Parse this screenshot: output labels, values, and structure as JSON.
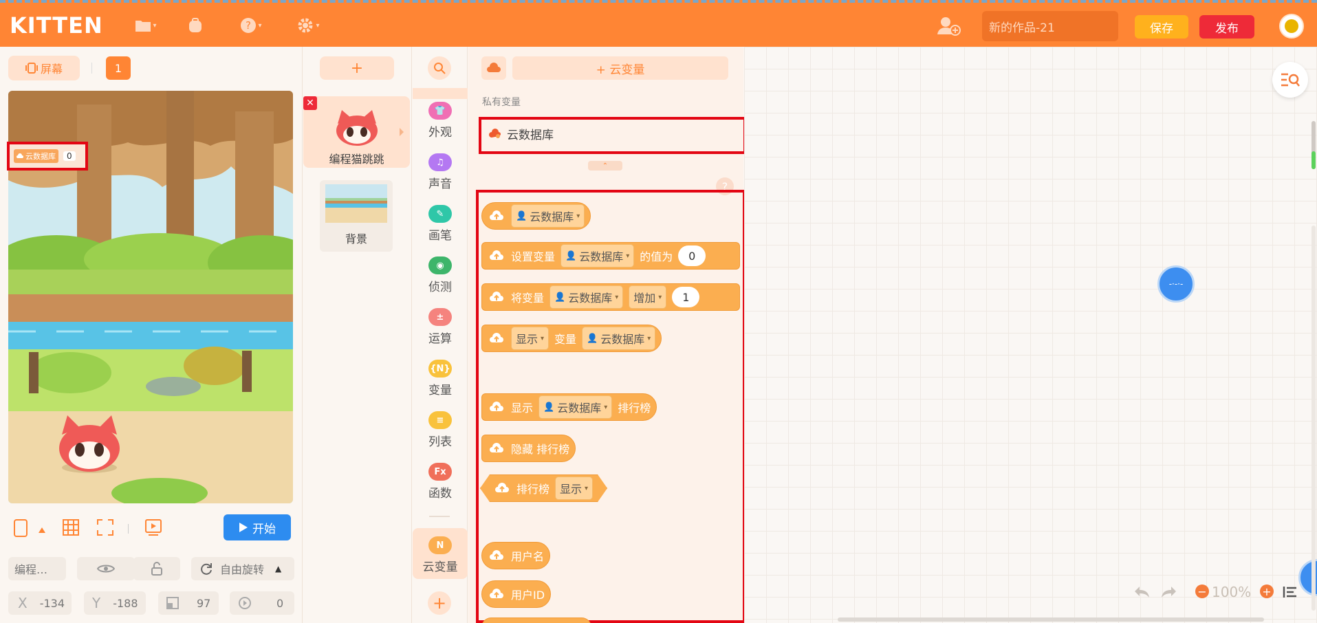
{
  "header": {
    "logo": "KITTEN",
    "title_value": "新的作品-21",
    "save_label": "保存",
    "publish_label": "发布",
    "icons": [
      "folder-icon",
      "backpack-icon",
      "help-icon",
      "settings-icon",
      "add-user-icon"
    ]
  },
  "stage": {
    "screen_label": "屏幕",
    "screen_index": "1",
    "monitor_label": "云数据库",
    "monitor_value": "0",
    "start_label": "开始",
    "sprite_name_short": "编程…",
    "rotation_label": "自由旋转",
    "x_label": "X",
    "x_value": "-134",
    "y_label": "Y",
    "y_value": "-188",
    "size_value": "97",
    "direction_value": "0"
  },
  "sprites": {
    "add_label": "+",
    "sprite_name": "编程猫跳跳",
    "background_name": "背景"
  },
  "categories": [
    {
      "label": "外观",
      "color": "#f06fb4",
      "glyph": "👕"
    },
    {
      "label": "声音",
      "color": "#b478f2",
      "glyph": "♫"
    },
    {
      "label": "画笔",
      "color": "#2fc7a8",
      "glyph": "✎"
    },
    {
      "label": "侦测",
      "color": "#3db56a",
      "glyph": "◉"
    },
    {
      "label": "运算",
      "color": "#f5837e",
      "glyph": "±"
    },
    {
      "label": "变量",
      "color": "#f9c23c",
      "glyph": "{N}"
    },
    {
      "label": "列表",
      "color": "#f9c23c",
      "glyph": "≡"
    },
    {
      "label": "函数",
      "color": "#f06f5a",
      "glyph": "Fx"
    }
  ],
  "active_category": {
    "label": "云变量",
    "glyph": "N",
    "color": "#fbae50"
  },
  "palette": {
    "cloud_var_button": "+ 云变量",
    "private_label": "私有变量",
    "variable_name": "云数据库",
    "blocks": {
      "b1_var": "云数据库",
      "b2_prefix": "设置变量",
      "b2_var": "云数据库",
      "b2_mid": "的值为",
      "b2_value": "0",
      "b3_prefix": "将变量",
      "b3_var": "云数据库",
      "b3_op": "增加",
      "b3_value": "1",
      "b4_op": "显示",
      "b4_mid": "变量",
      "b4_var": "云数据库",
      "b5_prefix": "显示",
      "b5_var": "云数据库",
      "b5_suffix": "排行榜",
      "b6_text": "隐藏 排行榜",
      "b7_prefix": "排行榜",
      "b7_op": "显示",
      "b8_text": "用户名",
      "b9_text": "用户ID"
    }
  },
  "workspace": {
    "zoom": "100%"
  },
  "colors": {
    "brand": "#ff8534",
    "save": "#ffb11d",
    "publish": "#ee2a38",
    "block": "#fbae50",
    "start": "#2d8cf0",
    "highlight": "#e30613"
  }
}
